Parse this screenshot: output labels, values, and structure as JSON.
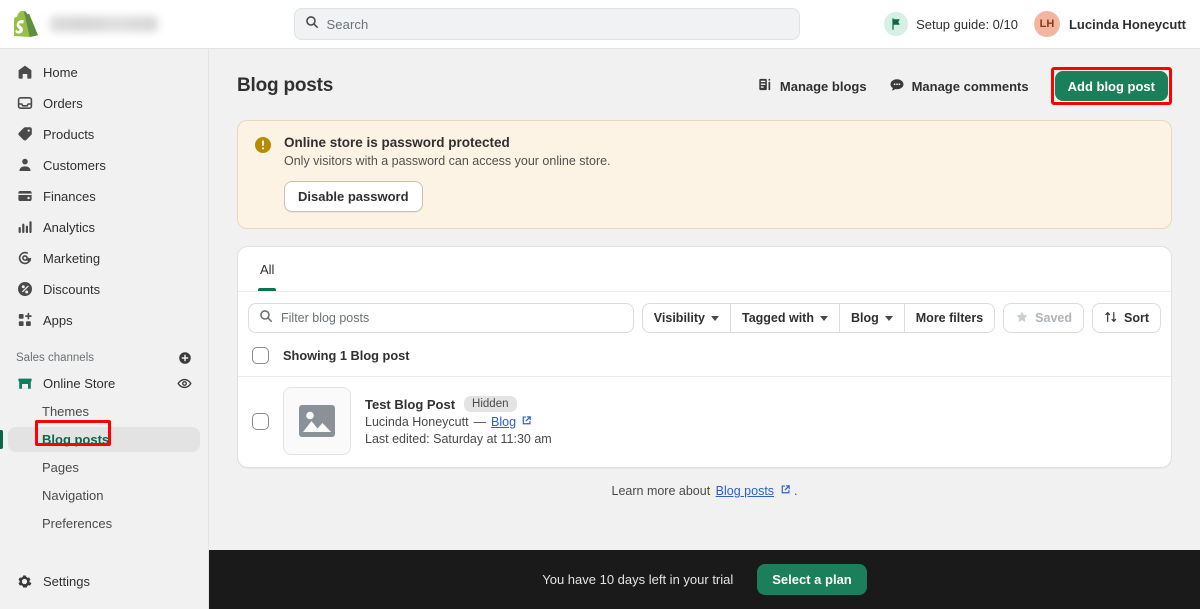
{
  "topbar": {
    "logo_icon": "shopify-bag-icon",
    "store_name_redacted": "",
    "search": {
      "icon": "search-icon",
      "placeholder": "Search",
      "value": ""
    },
    "setup_guide": {
      "icon": "flag-icon",
      "label": "Setup guide: 0/10"
    },
    "user": {
      "initials": "LH",
      "name": "Lucinda Honeycutt"
    }
  },
  "sidebar": {
    "items": [
      {
        "label": "Home",
        "icon": "home-icon"
      },
      {
        "label": "Orders",
        "icon": "orders-inbox-icon"
      },
      {
        "label": "Products",
        "icon": "products-tag-icon"
      },
      {
        "label": "Customers",
        "icon": "customers-person-icon"
      },
      {
        "label": "Finances",
        "icon": "finances-wallet-icon"
      },
      {
        "label": "Analytics",
        "icon": "analytics-bars-icon"
      },
      {
        "label": "Marketing",
        "icon": "marketing-target-icon"
      },
      {
        "label": "Discounts",
        "icon": "discounts-percent-icon"
      },
      {
        "label": "Apps",
        "icon": "apps-grid-icon"
      }
    ],
    "sales_channels": {
      "title": "Sales channels",
      "add_icon": "plus-circle-icon",
      "channel": {
        "label": "Online Store",
        "icon": "storefront-icon",
        "view_icon": "eye-icon"
      },
      "sub_items": [
        {
          "label": "Themes",
          "active": false
        },
        {
          "label": "Blog posts",
          "active": true
        },
        {
          "label": "Pages",
          "active": false
        },
        {
          "label": "Navigation",
          "active": false
        },
        {
          "label": "Preferences",
          "active": false
        }
      ]
    },
    "settings": {
      "label": "Settings",
      "icon": "gear-icon"
    }
  },
  "page": {
    "title": "Blog posts",
    "actions": {
      "manage_blogs": {
        "label": "Manage blogs",
        "icon": "blog-icon"
      },
      "manage_comments": {
        "label": "Manage comments",
        "icon": "comment-bubble-icon"
      },
      "add_blog_post": {
        "label": "Add blog post"
      }
    }
  },
  "banner": {
    "icon": "warning-exclamation-icon",
    "title": "Online store is password protected",
    "subtitle": "Only visitors with a password can access your online store.",
    "button_label": "Disable password"
  },
  "list_card": {
    "tabs": [
      {
        "label": "All",
        "active": true
      }
    ],
    "filter_input": {
      "icon": "search-icon",
      "placeholder": "Filter blog posts",
      "value": ""
    },
    "filter_buttons": [
      {
        "label": "Visibility",
        "has_caret": true,
        "disabled": false
      },
      {
        "label": "Tagged with",
        "has_caret": true,
        "disabled": false
      },
      {
        "label": "Blog",
        "has_caret": true,
        "disabled": false
      },
      {
        "label": "More filters",
        "has_caret": false,
        "disabled": false
      }
    ],
    "saved_button": {
      "label": "Saved",
      "icon": "star-icon",
      "disabled": true
    },
    "sort_button": {
      "label": "Sort",
      "icon": "sort-arrows-icon"
    },
    "showing_text": "Showing 1 Blog post",
    "rows": [
      {
        "thumb_icon": "image-placeholder-icon",
        "title": "Test Blog Post",
        "badge": "Hidden",
        "author": "Lucinda Honeycutt",
        "separator": "—",
        "blog_link": "Blog",
        "external_icon": "external-link-icon",
        "last_edited": "Last edited: Saturday at 11:30 am"
      }
    ]
  },
  "footer": {
    "learn_prefix": "Learn more about",
    "learn_link": "Blog posts",
    "learn_icon": "external-link-icon",
    "learn_suffix": "."
  },
  "trial_bar": {
    "text": "You have 10 days left in your trial",
    "button_label": "Select a plan"
  },
  "colors": {
    "brand_green": "#1a7f5a",
    "active_green": "#0a6847",
    "annotation_red": "#ff0000",
    "banner_bg": "#fdf3e4",
    "trial_bar_bg": "#1a1a1a",
    "avatar_bg": "#f2b5a0"
  }
}
